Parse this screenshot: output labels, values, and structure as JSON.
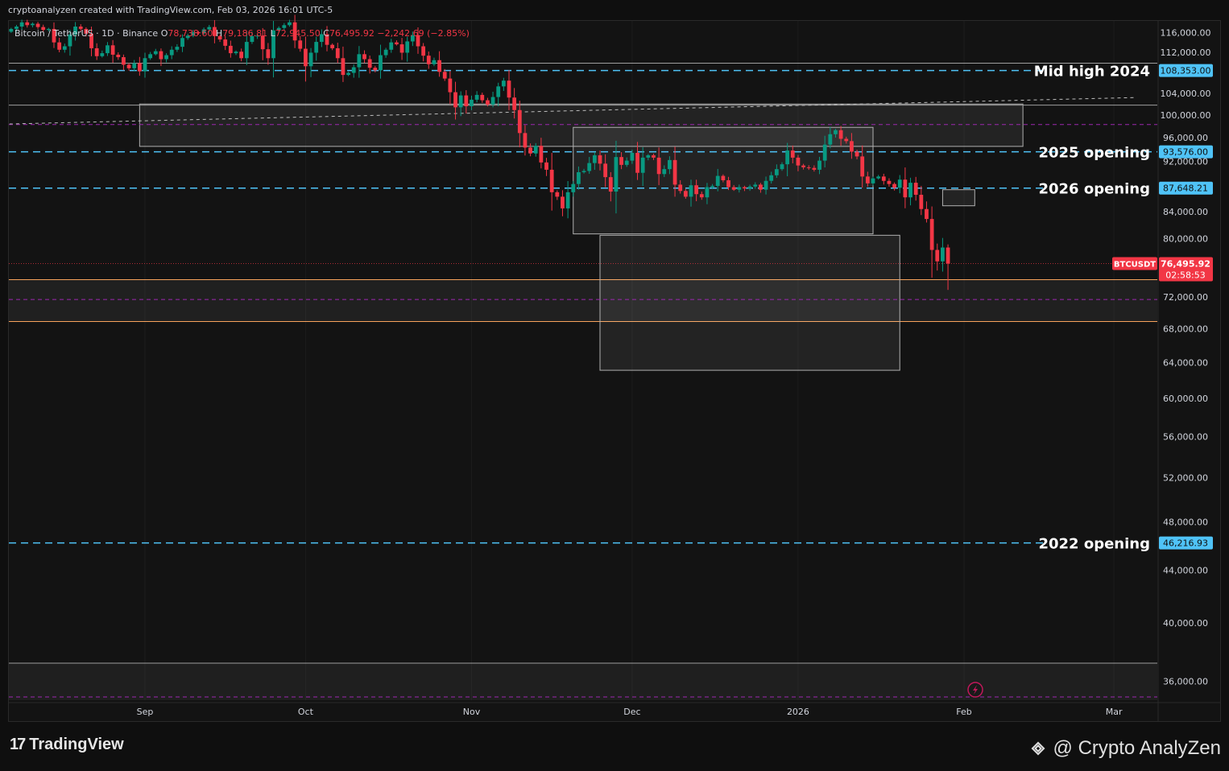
{
  "header": {
    "attribution": "cryptoanalyzen created with TradingView.com, Feb 03, 2026 16:01 UTC-5"
  },
  "legend": {
    "symbol": "Bitcoin / TetherUS · 1D · Binance",
    "o_label": "O",
    "o": "78,738.60",
    "h_label": "H",
    "h": "79,186.81",
    "l_label": "L",
    "l": "72,945.50",
    "c_label": "C",
    "c": "76,495.92",
    "change": "−2,242.69 (−2.85%)"
  },
  "colors": {
    "up": "#089981",
    "down": "#f23645",
    "level": "#4fc3f7",
    "zone_line": "#9e9e9e",
    "purple": "#9c27b0",
    "orange": "#f7a35c",
    "price_tag": "#f23645",
    "bg": "#131313"
  },
  "chart_data": {
    "type": "candlestick",
    "symbol": "BTCUSDT",
    "interval": "1D",
    "y_scale": "log",
    "ylim": [
      34800,
      118500
    ],
    "y_ticks": [
      "116,000.00",
      "112,000.00",
      "104,000.00",
      "100,000.00",
      "96,000.00",
      "92,000.00",
      "84,000.00",
      "80,000.00",
      "72,000.00",
      "68,000.00",
      "64,000.00",
      "60,000.00",
      "56,000.00",
      "52,000.00",
      "48,000.00",
      "44,000.00",
      "40,000.00",
      "36,000.00"
    ],
    "y_tick_values": [
      116000,
      112000,
      104000,
      100000,
      96000,
      92000,
      84000,
      80000,
      72000,
      68000,
      64000,
      60000,
      56000,
      52000,
      48000,
      44000,
      40000,
      36000
    ],
    "x_ticks": [
      {
        "label": "Sep",
        "date": "2025-09-01"
      },
      {
        "label": "Oct",
        "date": "2025-10-01"
      },
      {
        "label": "Nov",
        "date": "2025-11-01"
      },
      {
        "label": "Dec",
        "date": "2025-12-01"
      },
      {
        "label": "2026",
        "date": "2026-01-01"
      },
      {
        "label": "Feb",
        "date": "2026-02-01"
      },
      {
        "label": "Mar",
        "date": "2026-03-01"
      }
    ],
    "series_start": "2025-08-07",
    "series_end": "2026-02-03",
    "closes": [
      116800,
      117300,
      118200,
      117600,
      117900,
      117200,
      116600,
      116800,
      114000,
      112500,
      113200,
      115600,
      117300,
      116800,
      115800,
      112800,
      111200,
      111800,
      113400,
      111500,
      111000,
      109500,
      108800,
      109800,
      108200,
      110800,
      111600,
      112200,
      110600,
      111400,
      112500,
      113100,
      114900,
      115400,
      116100,
      115900,
      116700,
      117200,
      115300,
      114600,
      113300,
      111800,
      112100,
      110800,
      114100,
      115300,
      115400,
      112600,
      110800,
      116500,
      117000,
      117600,
      118200,
      114400,
      112700,
      109200,
      111900,
      114100,
      115700,
      113500,
      112800,
      110800,
      107500,
      107900,
      109000,
      111600,
      110600,
      108900,
      108400,
      111400,
      112500,
      114000,
      113600,
      111900,
      114200,
      115500,
      113200,
      111300,
      109600,
      110400,
      108100,
      106800,
      104200,
      101400,
      103600,
      101600,
      102800,
      103700,
      102700,
      101900,
      103300,
      105300,
      106400,
      103200,
      100900,
      96800,
      94300,
      93300,
      94600,
      91800,
      90600,
      87000,
      86300,
      84500,
      87000,
      88300,
      90200,
      90400,
      91700,
      93000,
      91600,
      89400,
      87100,
      92700,
      91400,
      92100,
      93400,
      90100,
      92600,
      93000,
      92600,
      89900,
      90700,
      92200,
      88200,
      87200,
      86300,
      88100,
      86700,
      86200,
      87800,
      88000,
      89600,
      88900,
      87800,
      87400,
      87800,
      87600,
      87900,
      88200,
      87400,
      88800,
      89700,
      90700,
      91500,
      93800,
      92600,
      91300,
      91000,
      90900,
      90600,
      92100,
      94800,
      96600,
      97300,
      95800,
      95400,
      93600,
      92800,
      89500,
      88400,
      89200,
      89500,
      88800,
      88300,
      87700,
      89000,
      86200,
      88500,
      86600,
      84400,
      82900,
      78400,
      76800,
      78740,
      76496
    ],
    "last": {
      "o": 78738.6,
      "h": 79186.81,
      "l": 72945.5,
      "c": 76495.92
    },
    "levels": [
      {
        "price": 108353,
        "label": "Mid high 2024",
        "tag": "108,353.00"
      },
      {
        "price": 93576,
        "label": "2025 opening",
        "tag": "93,576.00"
      },
      {
        "price": 87648.21,
        "label": "2026 opening",
        "tag": "87,648.21"
      },
      {
        "price": 46216.93,
        "label": "2022 opening",
        "tag": "46,216.93"
      }
    ],
    "purple_levels": [
      98300,
      71700,
      35000
    ],
    "white_levels": [
      109800,
      101800,
      37200
    ],
    "orange_zone": [
      68900,
      74300
    ],
    "zones": [
      {
        "x0": "2025-08-31",
        "x1": "2026-02-12",
        "y0": 94500,
        "y1": 102000
      },
      {
        "x0": "2025-11-20",
        "x1": "2026-01-15",
        "y0": 80700,
        "y1": 97800
      },
      {
        "x0": "2025-11-25",
        "x1": "2026-01-20",
        "y0": 63100,
        "y1": 80500
      },
      {
        "x0": "2026-01-28",
        "x1": "2026-02-03",
        "y0": 84900,
        "y1": 87400
      }
    ],
    "trend": [
      {
        "date": "2025-08-07",
        "price": 98400
      },
      {
        "date": "2026-03-05",
        "price": 103200
      }
    ],
    "price_tag": {
      "symbol": "BTCUSDT",
      "price": "76,495.92",
      "countdown": "02:58:53"
    }
  },
  "footer": {
    "brand": "TradingView",
    "watermark": "@ Crypto AnalyZen"
  }
}
